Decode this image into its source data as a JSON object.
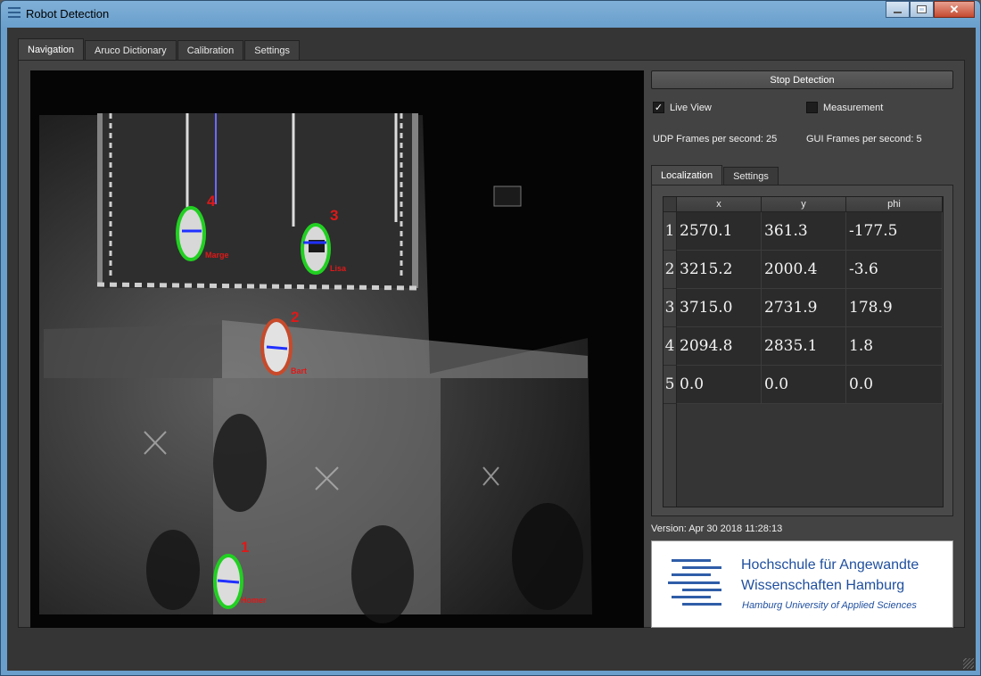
{
  "window": {
    "title": "Robot Detection"
  },
  "tabs": [
    "Navigation",
    "Aruco Dictionary",
    "Calibration",
    "Settings"
  ],
  "controls": {
    "stop_label": "Stop Detection",
    "live_view_label": "Live View",
    "live_view_checked": true,
    "measurement_label": "Measurement",
    "measurement_checked": false,
    "udp_fps": "UDP Frames per second: 25",
    "gui_fps": "GUI Frames per second: 5"
  },
  "subtabs": [
    "Localization",
    "Settings"
  ],
  "localization": {
    "columns": [
      "x",
      "y",
      "phi"
    ],
    "rows": [
      {
        "id": "1",
        "x": "2570.1",
        "y": "361.3",
        "phi": "-177.5"
      },
      {
        "id": "2",
        "x": "3215.2",
        "y": "2000.4",
        "phi": "-3.6"
      },
      {
        "id": "3",
        "x": "3715.0",
        "y": "2731.9",
        "phi": "178.9"
      },
      {
        "id": "4",
        "x": "2094.8",
        "y": "2835.1",
        "phi": "1.8"
      },
      {
        "id": "5",
        "x": "0.0",
        "y": "0.0",
        "phi": "0.0"
      }
    ]
  },
  "version": "Version: Apr 30 2018 11:28:13",
  "logo": {
    "line1": "Hochschule für Angewandte",
    "line2": "Wissenschaften Hamburg",
    "line3": "Hamburg University of Applied Sciences"
  },
  "robots": [
    {
      "number": "1",
      "name": "Homer",
      "ring": "#21d021"
    },
    {
      "number": "2",
      "name": "Bart",
      "ring": "#c84a2a"
    },
    {
      "number": "3",
      "name": "Lisa",
      "ring": "#21d021"
    },
    {
      "number": "4",
      "name": "Marge",
      "ring": "#21d021"
    }
  ],
  "colors": {
    "label_red": "#e01818",
    "marker_blue": "#2030ff"
  }
}
